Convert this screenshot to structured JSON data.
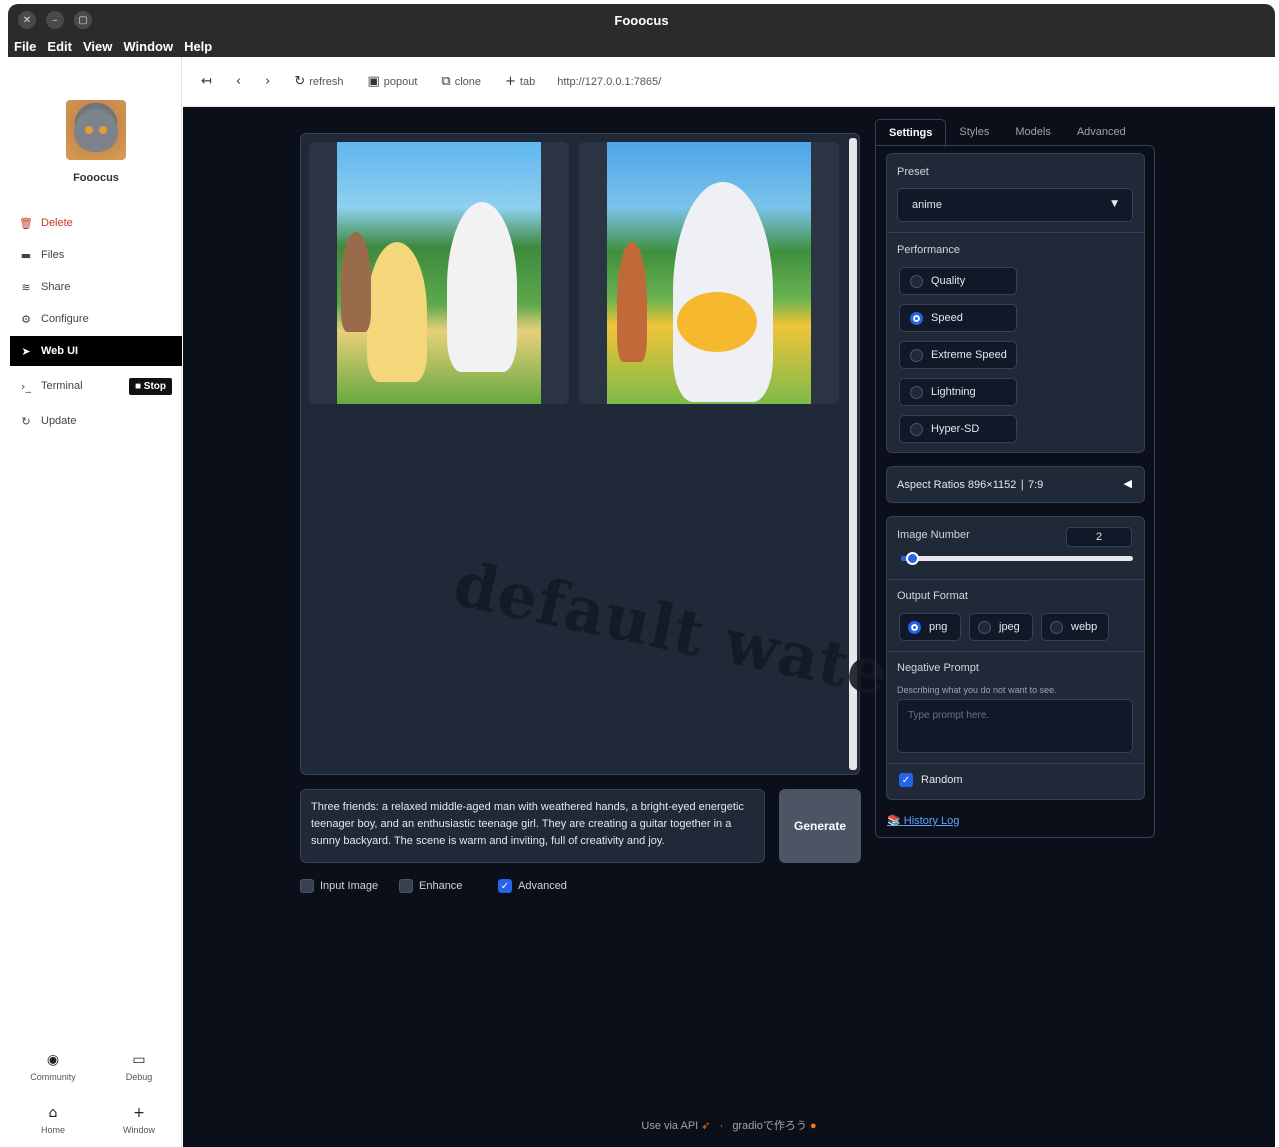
{
  "window": {
    "title": "Fooocus"
  },
  "menu": [
    "File",
    "Edit",
    "View",
    "Window",
    "Help"
  ],
  "sidebar": {
    "app_name": "Fooocus",
    "items": [
      {
        "label": "Delete",
        "icon": "trash-icon"
      },
      {
        "label": "Files",
        "icon": "folder-icon"
      },
      {
        "label": "Share",
        "icon": "wifi-icon"
      },
      {
        "label": "Configure",
        "icon": "gear-icon"
      },
      {
        "label": "Web UI",
        "icon": "rocket-icon"
      },
      {
        "label": "Terminal",
        "icon": "terminal-icon"
      },
      {
        "label": "Update",
        "icon": "refresh-icon"
      }
    ],
    "stop_label": "Stop",
    "bottom": [
      {
        "label": "Community",
        "icon": "globe-icon"
      },
      {
        "label": "Debug",
        "icon": "monitor-icon"
      },
      {
        "label": "Home",
        "icon": "home-icon"
      },
      {
        "label": "Window",
        "icon": "plus-icon"
      }
    ]
  },
  "toolbar": {
    "refresh": "refresh",
    "popout": "popout",
    "clone": "clone",
    "tab": "tab",
    "url": "http://127.0.0.1:7865/"
  },
  "main": {
    "prompt": "Three friends: a relaxed middle-aged man with weathered hands, a bright-eyed energetic teenager boy, and an enthusiastic teenage girl. They are creating a guitar together in a sunny backyard. The scene is warm and inviting, full of creativity and joy.",
    "generate": "Generate",
    "checks": [
      {
        "label": "Input Image",
        "checked": false
      },
      {
        "label": "Enhance",
        "checked": false
      },
      {
        "label": "Advanced",
        "checked": true
      }
    ],
    "watermark": "default watermark"
  },
  "panel": {
    "tabs": [
      "Settings",
      "Styles",
      "Models",
      "Advanced"
    ],
    "active_tab": "Settings",
    "preset_label": "Preset",
    "preset_value": "anime",
    "performance_label": "Performance",
    "performance_options": [
      "Quality",
      "Speed",
      "Extreme Speed",
      "Lightning",
      "Hyper-SD"
    ],
    "performance_selected": "Speed",
    "aspect_label": "Aspect Ratios 896×1152 ∣ 7:9",
    "image_number_label": "Image Number",
    "image_number_value": "2",
    "image_number_fraction": 0.03,
    "output_format_label": "Output Format",
    "output_formats": [
      "png",
      "jpeg",
      "webp"
    ],
    "output_selected": "png",
    "negative_label": "Negative Prompt",
    "negative_desc": "Describing what you do not want to see.",
    "negative_placeholder": "Type prompt here.",
    "random_label": "Random",
    "history_link": "History Log"
  },
  "footer": {
    "api": "Use via API",
    "gradio": "gradioで作ろう"
  },
  "colors": {
    "accent": "#2563eb",
    "background": "#0b0f19",
    "card": "#1f2937"
  }
}
